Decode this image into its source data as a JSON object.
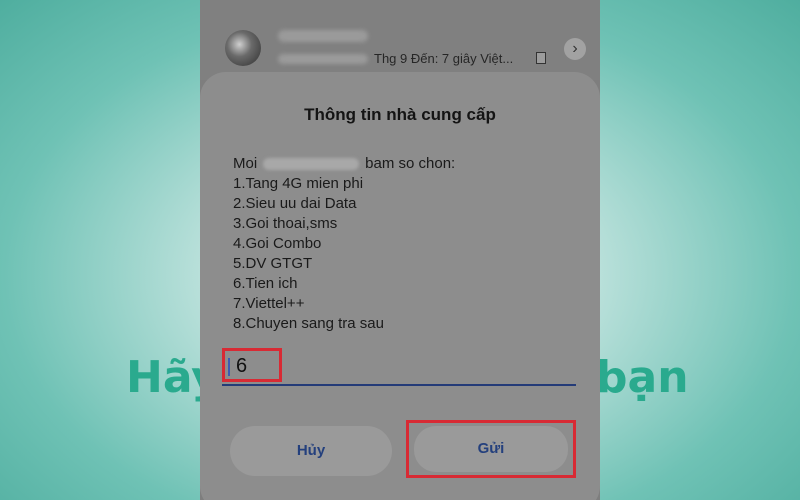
{
  "background": {
    "text_left": "Hãy",
    "text_right": "bạn"
  },
  "conversation": {
    "preview": "Thg 9 Đến: 7 giây  Việt..."
  },
  "dialog": {
    "title": "Thông tin nhà cung cấp",
    "greeting_prefix": "Moi",
    "greeting_suffix": "bam so chon:",
    "options": [
      "1.Tang 4G mien phi",
      "2.Sieu uu dai Data",
      "3.Goi thoai,sms",
      "4.Goi Combo",
      "5.DV GTGT",
      "6.Tien ich",
      "7.Viettel++",
      "8.Chuyen sang tra sau"
    ],
    "input_value": "6",
    "cancel_label": "Hủy",
    "send_label": "Gửi"
  },
  "icons": {
    "chevron": "chevron-right-icon",
    "document": "document-icon"
  },
  "colors": {
    "highlight": "#d82a34",
    "button_text": "#24407d",
    "background_text": "#2aaa8e"
  }
}
